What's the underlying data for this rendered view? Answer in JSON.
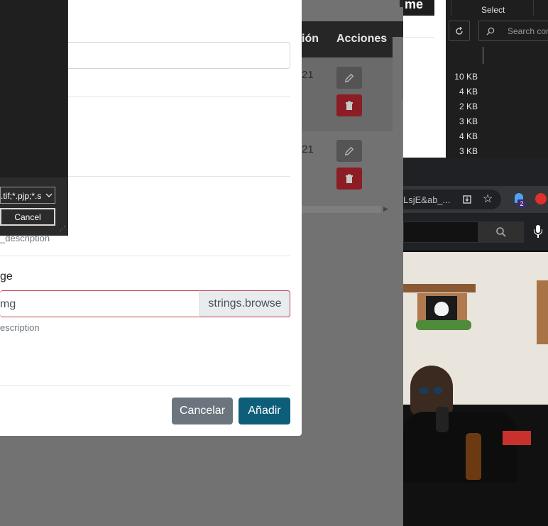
{
  "modal": {
    "field2_help": "_description",
    "image_label": "ge",
    "image_input_value": "mg",
    "browse_button": "strings.browse",
    "image_help": "escription",
    "cancel_button": "Cancelar",
    "add_button": "Añadir"
  },
  "file_dialog": {
    "filter_value": ".tif;*.pjp;*.s",
    "cancel_button": "Cancel"
  },
  "table": {
    "col_partial": "ión",
    "col_actions": "Acciones",
    "row1_partial": "21",
    "row2_partial": "21"
  },
  "explorer": {
    "select_label": "Select",
    "search_placeholder": "Search con",
    "sizes": [
      "10 KB",
      "4 KB",
      "2 KB",
      "3 KB",
      "4 KB",
      "3 KB"
    ],
    "title_partial": "me"
  },
  "browser": {
    "url_partial": "LsjE&ab_...",
    "badge_count": "2"
  },
  "colors": {
    "primary": "#0e5e7a",
    "secondary": "#6c757d",
    "danger": "#dc3545",
    "invalid_border": "#c23f4d"
  }
}
